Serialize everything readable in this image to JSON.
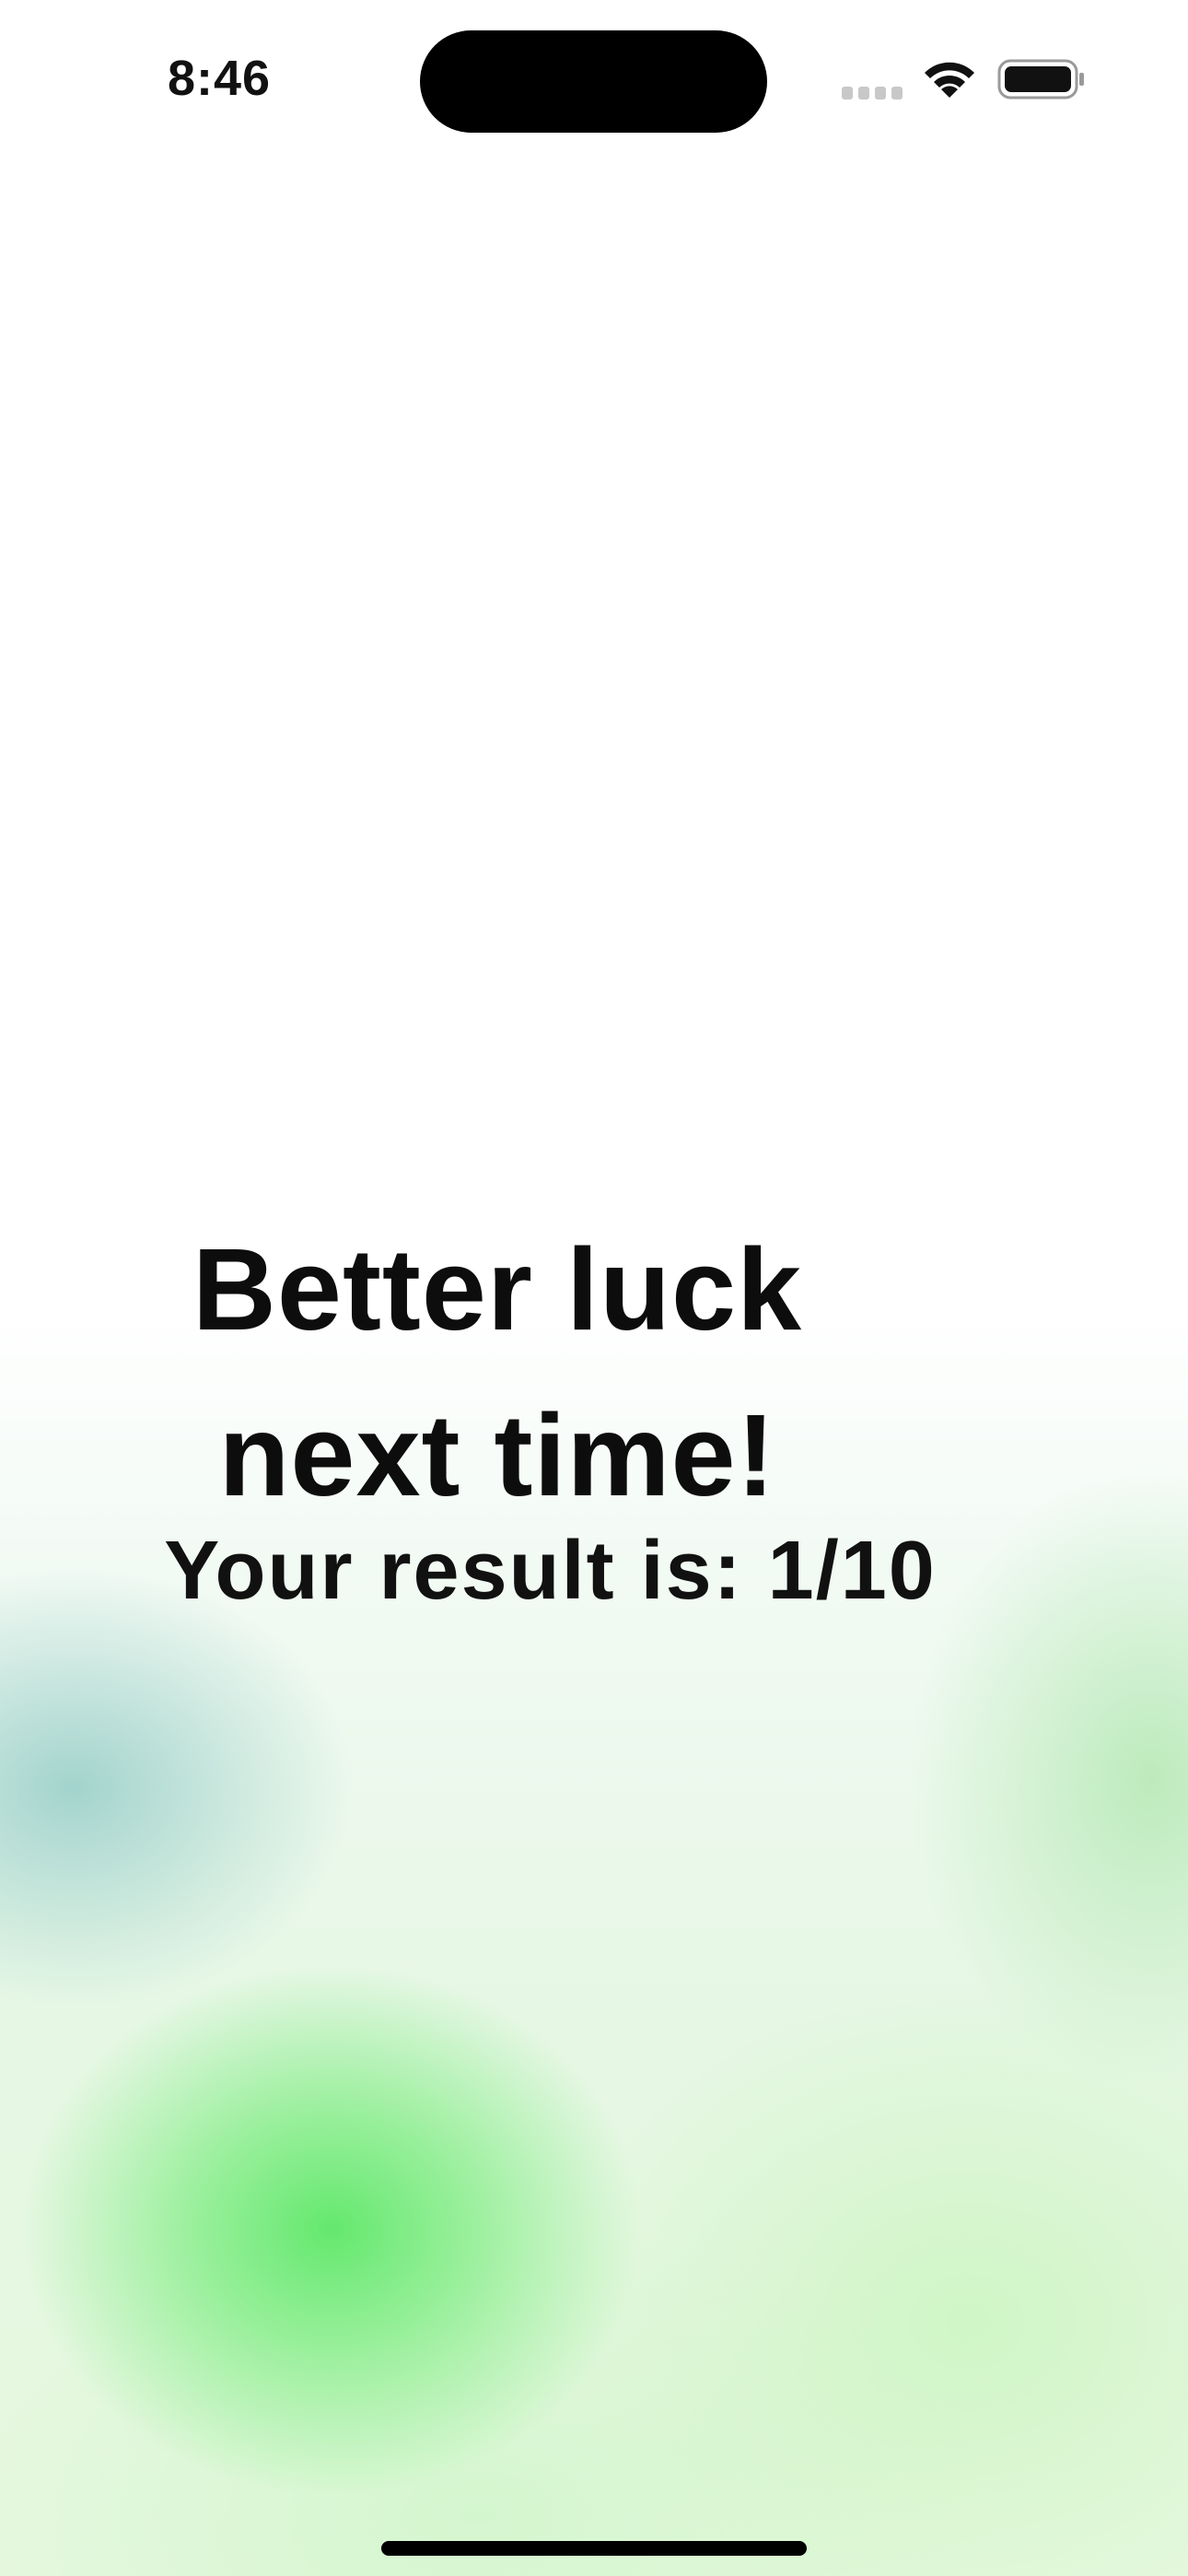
{
  "status_bar": {
    "time": "8:46",
    "icons": [
      "cellular-signal-icon",
      "wifi-icon",
      "battery-icon"
    ]
  },
  "result_screen": {
    "headline_line1": "Better luck",
    "headline_line2": "next time!",
    "result_text": "Your result is: 1/10"
  },
  "colors": {
    "text": "#0d0d0d",
    "accent_green": "#6ee66e",
    "teal_glow": "#96cdc8"
  }
}
